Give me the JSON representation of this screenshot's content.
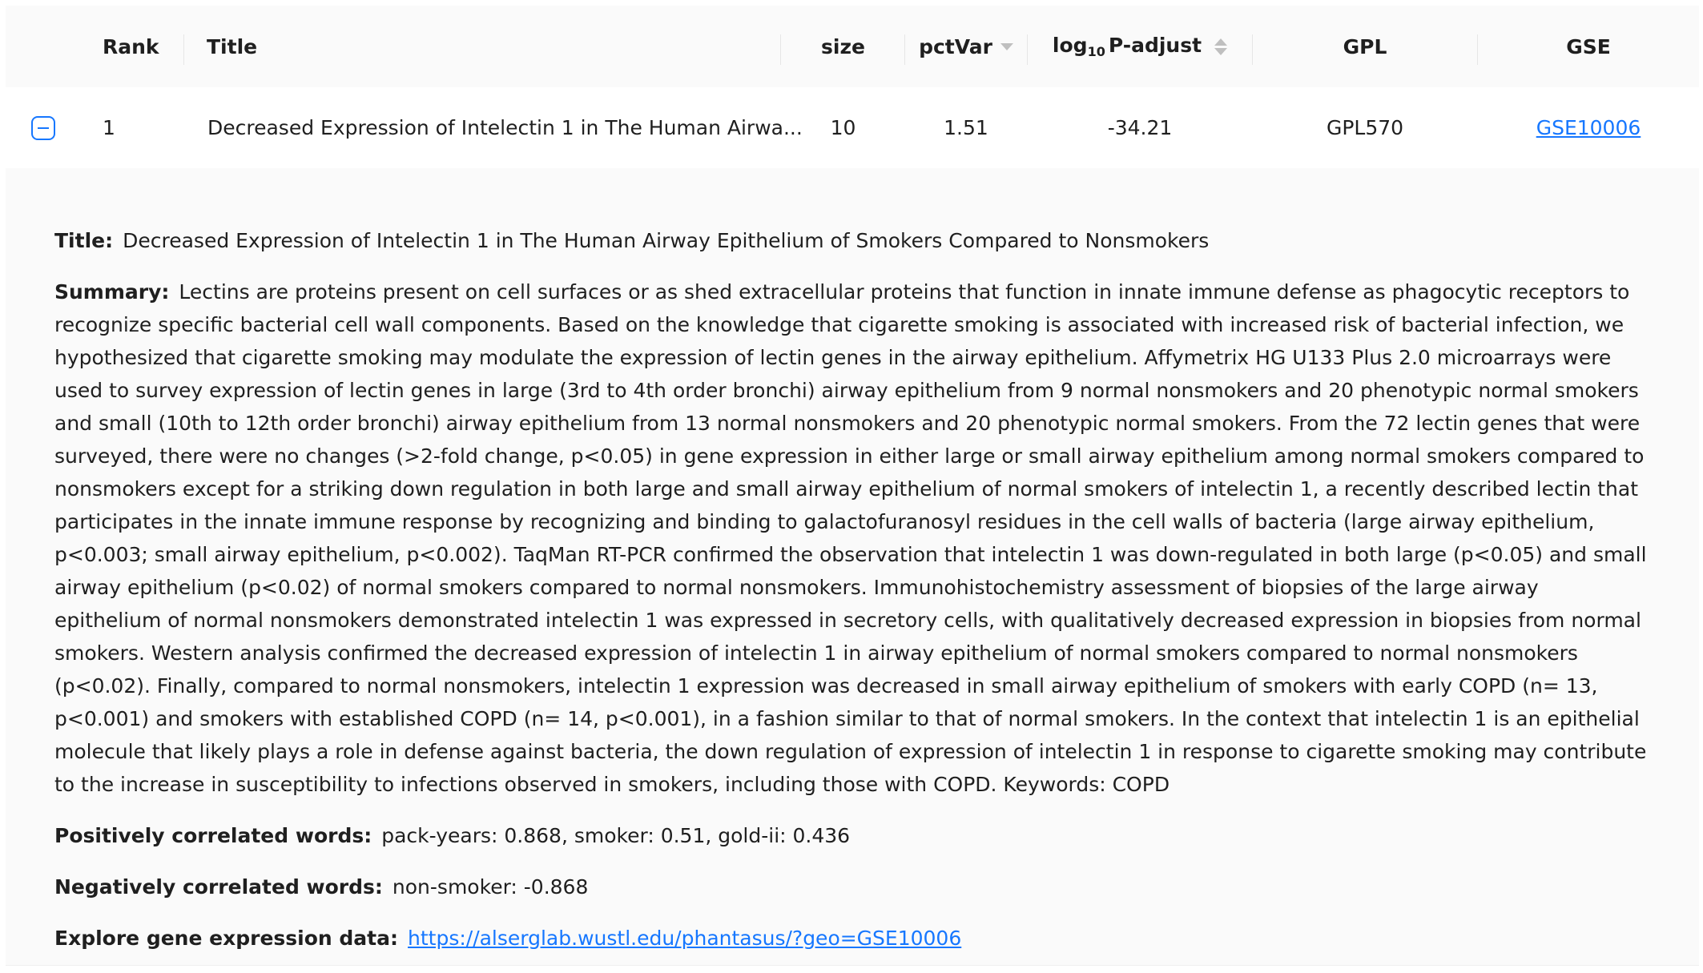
{
  "table": {
    "columns": {
      "rank": "Rank",
      "title": "Title",
      "size": "size",
      "pctvar": "pctVar",
      "padj_prefix": "log",
      "padj_sub": "10",
      "padj_suffix": "P-adjust",
      "gpl": "GPL",
      "gse": "GSE"
    },
    "sort": {
      "pctvar": "descending",
      "padj": "none"
    },
    "rows": [
      {
        "rank": "1",
        "title": "Decreased Expression of Intelectin 1 in The Human Airwa...",
        "size": "10",
        "pctvar": "1.51",
        "padj": "-34.21",
        "gpl": "GPL570",
        "gse": "GSE10006",
        "expanded": true
      }
    ]
  },
  "details": {
    "title_label": "Title:",
    "title_value": "Decreased Expression of Intelectin 1 in The Human Airway Epithelium of Smokers Compared to Nonsmokers",
    "summary_label": "Summary:",
    "summary_value": "Lectins are proteins present on cell surfaces or as shed extracellular proteins that function in innate immune defense as phagocytic receptors to recognize specific bacterial cell wall components. Based on the knowledge that cigarette smoking is associated with increased risk of bacterial infection, we hypothesized that cigarette smoking may modulate the expression of lectin genes in the airway epithelium. Affymetrix HG U133 Plus 2.0 microarrays were used to survey expression of lectin genes in large (3rd to 4th order bronchi) airway epithelium from 9 normal nonsmokers and 20 phenotypic normal smokers and small (10th to 12th order bronchi) airway epithelium from 13 normal nonsmokers and 20 phenotypic normal smokers. From the 72 lectin genes that were surveyed, there were no changes (>2-fold change, p<0.05) in gene expression in either large or small airway epithelium among normal smokers compared to nonsmokers except for a striking down regulation in both large and small airway epithelium of normal smokers of intelectin 1, a recently described lectin that participates in the innate immune response by recognizing and binding to galactofuranosyl residues in the cell walls of bacteria (large airway epithelium, p<0.003; small airway epithelium, p<0.002). TaqMan RT-PCR confirmed the observation that intelectin 1 was down-regulated in both large (p<0.05) and small airway epithelium (p<0.02) of normal smokers compared to normal nonsmokers. Immunohistochemistry assessment of biopsies of the large airway epithelium of normal nonsmokers demonstrated intelectin 1 was expressed in secretory cells, with qualitatively decreased expression in biopsies from normal smokers. Western analysis confirmed the decreased expression of intelectin 1 in airway epithelium of normal smokers compared to normal nonsmokers (p<0.02). Finally, compared to normal nonsmokers, intelectin 1 expression was decreased in small airway epithelium of smokers with early COPD (n= 13, p<0.001) and smokers with established COPD (n= 14, p<0.001), in a fashion similar to that of normal smokers. In the context that intelectin 1 is an epithelial molecule that likely plays a role in defense against bacteria, the down regulation of expression of intelectin 1 in response to cigarette smoking may contribute to the increase in susceptibility to infections observed in smokers, including those with COPD. Keywords: COPD",
    "positive_label": "Positively correlated words:",
    "positive_value": "pack-years: 0.868, smoker: 0.51, gold-ii: 0.436",
    "negative_label": "Negatively correlated words:",
    "negative_value": "non-smoker: -0.868",
    "explore_label": "Explore gene expression data:",
    "explore_link": "https://alserglab.wustl.edu/phantasus/?geo=GSE10006"
  },
  "colors": {
    "accent": "#1677ff",
    "header_bg": "#fafafa",
    "expanded_bg": "#fafafa",
    "sort_icon": "#bfbfbf"
  },
  "icons": {
    "expand_toggle": "collapse-minus-icon",
    "sort_pctvar": "sort-descending-icon",
    "sort_padj": "sort-icon"
  }
}
